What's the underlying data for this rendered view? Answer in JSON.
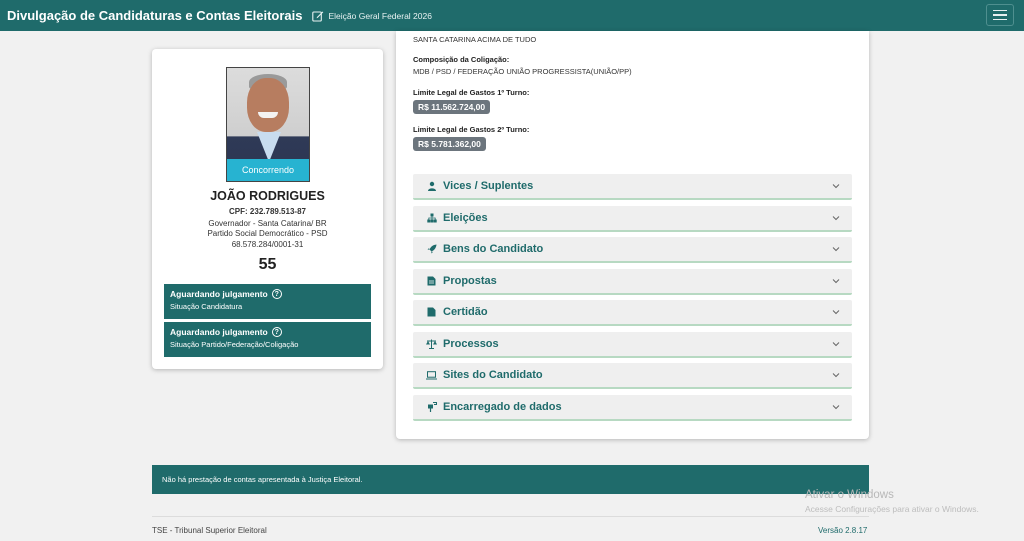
{
  "header": {
    "app_title": "Divulgação de Candidaturas e Contas Eleitorais",
    "election": "Eleição Geral Federal 2026",
    "edit_icon": "edit-icon",
    "menu_icon": "hamburger-menu-icon"
  },
  "candidate": {
    "status": "Concorrendo",
    "name": "JOÃO RODRIGUES",
    "cpf": "CPF: 232.789.513-87",
    "office": "Governador - Santa Catarina/ BR",
    "party": "Partido Social Democrático - PSD",
    "cnpj": "68.578.284/0001-31",
    "number": "55",
    "situations": [
      {
        "title": "Aguardando julgamento",
        "subtitle": "Situação Candidatura"
      },
      {
        "title": "Aguardando julgamento",
        "subtitle": "Situação Partido/Federação/Coligação"
      }
    ]
  },
  "details": {
    "coalition_name": "SANTA CATARINA ACIMA DE TUDO",
    "composition_label": "Composição da Coligação:",
    "composition_value": "MDB / PSD / FEDERAÇÃO UNIÃO PROGRESSISTA(UNIÃO/PP)",
    "limit1_label": "Limite Legal de Gastos 1º Turno:",
    "limit1_value": "R$ 11.562.724,00",
    "limit2_label": "Limite Legal de Gastos 2º Turno:",
    "limit2_value": "R$ 5.781.362,00"
  },
  "accordion": [
    {
      "label": "Vices / Suplentes",
      "icon": "user-icon"
    },
    {
      "label": "Eleições",
      "icon": "sitemap-icon"
    },
    {
      "label": "Bens do Candidato",
      "icon": "rocket-icon"
    },
    {
      "label": "Propostas",
      "icon": "document-icon"
    },
    {
      "label": "Certidão",
      "icon": "file-icon"
    },
    {
      "label": "Processos",
      "icon": "scale-icon"
    },
    {
      "label": "Sites do Candidato",
      "icon": "laptop-icon"
    },
    {
      "label": "Encarregado de dados",
      "icon": "mailbox-icon"
    }
  ],
  "footer": {
    "notice": "Não há prestação de contas apresentada à Justiça Eleitoral.",
    "org": "TSE - Tribunal Superior Eleitoral",
    "version": "Versão 2.8.17"
  },
  "watermark": {
    "line1": "Ativar o Windows",
    "line2": "Acesse Configurações para ativar o Windows."
  }
}
